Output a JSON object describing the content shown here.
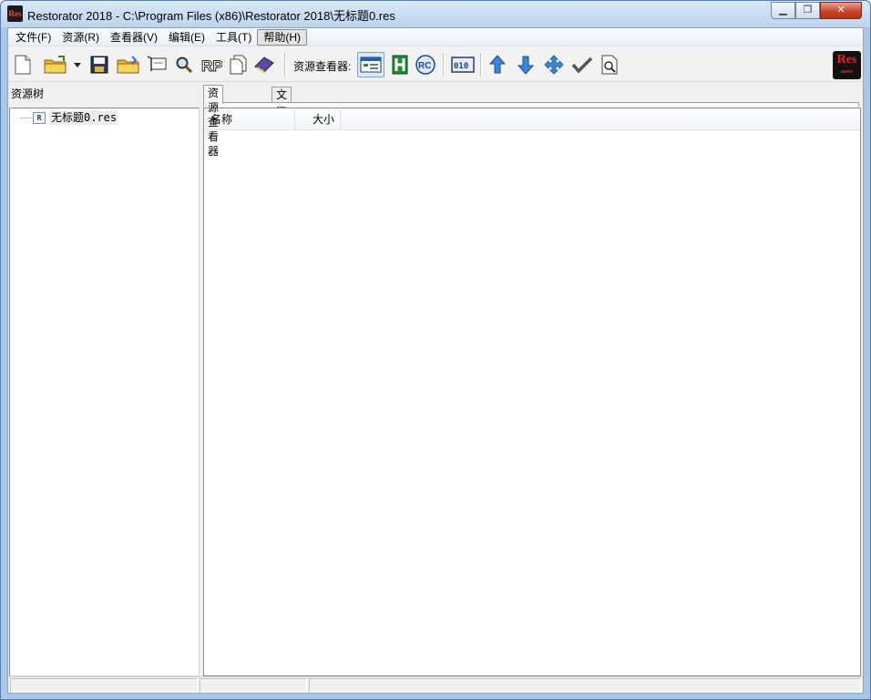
{
  "window": {
    "title": "Restorator 2018 - C:\\Program Files (x86)\\Restorator 2018\\无标题0.res",
    "app_icon_text": "Res",
    "minimize": "▁",
    "restore": "❐",
    "close": "✕"
  },
  "menu": [
    "文件(F)",
    "资源(R)",
    "查看器(V)",
    "编辑(E)",
    "工具(T)",
    "帮助(H)"
  ],
  "toolbar": {
    "viewer_label": "资源查看器:",
    "logo_text": "Res",
    "logo_sub": "more"
  },
  "left_pane": {
    "title": "资源树",
    "tree_items": [
      {
        "icon_text": "R",
        "label": "无标题0.res"
      }
    ]
  },
  "right_pane": {
    "tabs": [
      "资源查看器",
      "文件浏览器"
    ],
    "active_tab": 0,
    "columns": [
      "名称",
      "大小"
    ]
  },
  "colors": {
    "title_bar": "#bcd4ee",
    "close_button": "#c8442a",
    "accent_blue": "#2d6fc4",
    "logo_red": "#e02a2a"
  },
  "icons": [
    "new-file-icon",
    "open-folder-icon",
    "dropdown-arrow-icon",
    "save-icon",
    "open-project-icon",
    "rename-icon",
    "search-icon",
    "rp-icon",
    "copy-icon",
    "book-icon",
    "viewer-preview-icon",
    "hex-icon",
    "rc-icon",
    "binary-icon",
    "move-up-icon",
    "move-down-icon",
    "navigate-icon",
    "check-icon",
    "inspect-icon"
  ]
}
